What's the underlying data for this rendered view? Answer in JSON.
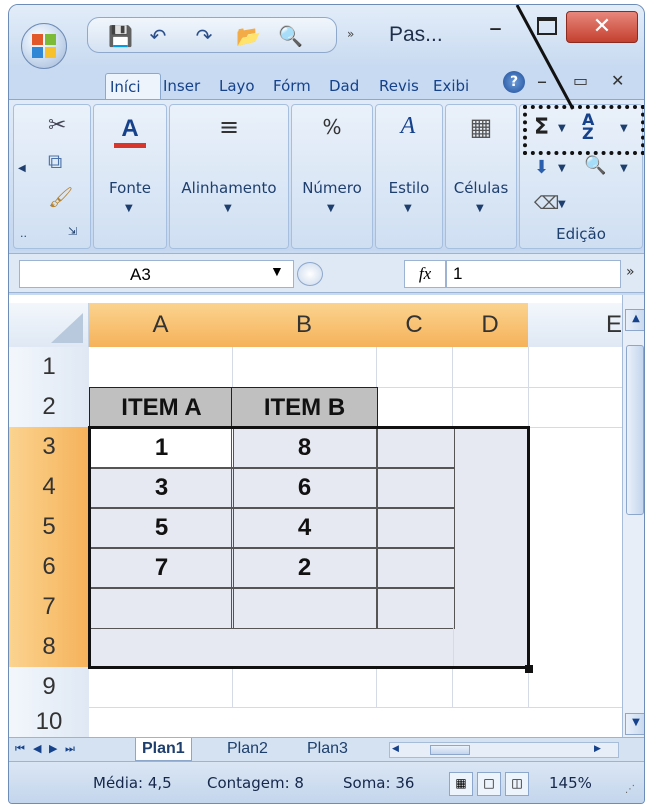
{
  "window": {
    "title": "Pas...",
    "accent_color": "#c4402f"
  },
  "quick_access": {
    "icons": [
      "save-icon",
      "undo-icon",
      "redo-icon",
      "open-folder-icon",
      "print-preview-icon"
    ]
  },
  "ribbon_tabs": [
    "Iníci",
    "Inser",
    "Layo",
    "Fórm",
    "Dad",
    "Revis",
    "Exibi"
  ],
  "ribbon_groups": {
    "fonte": "Fonte",
    "alinhamento": "Alinhamento",
    "numero": "Número",
    "numero_symbol": "%",
    "estilo": "Estilo",
    "celulas": "Células",
    "edicao": "Edição"
  },
  "formula_bar": {
    "name_box": "A3",
    "fx": "fx",
    "value": "1"
  },
  "grid": {
    "columns": [
      "A",
      "B",
      "C",
      "D",
      "E"
    ],
    "rows": [
      "1",
      "2",
      "3",
      "4",
      "5",
      "6",
      "7",
      "8",
      "9",
      "10"
    ],
    "table_header": [
      "ITEM A",
      "ITEM B"
    ],
    "table_rows": [
      [
        "1",
        "8"
      ],
      [
        "3",
        "6"
      ],
      [
        "5",
        "4"
      ],
      [
        "7",
        "2"
      ]
    ]
  },
  "sheets": [
    "Plan1",
    "Plan2",
    "Plan3"
  ],
  "status": {
    "media": "Média: 4,5",
    "contagem": "Contagem: 8",
    "soma": "Soma: 36",
    "zoom": "145%"
  }
}
